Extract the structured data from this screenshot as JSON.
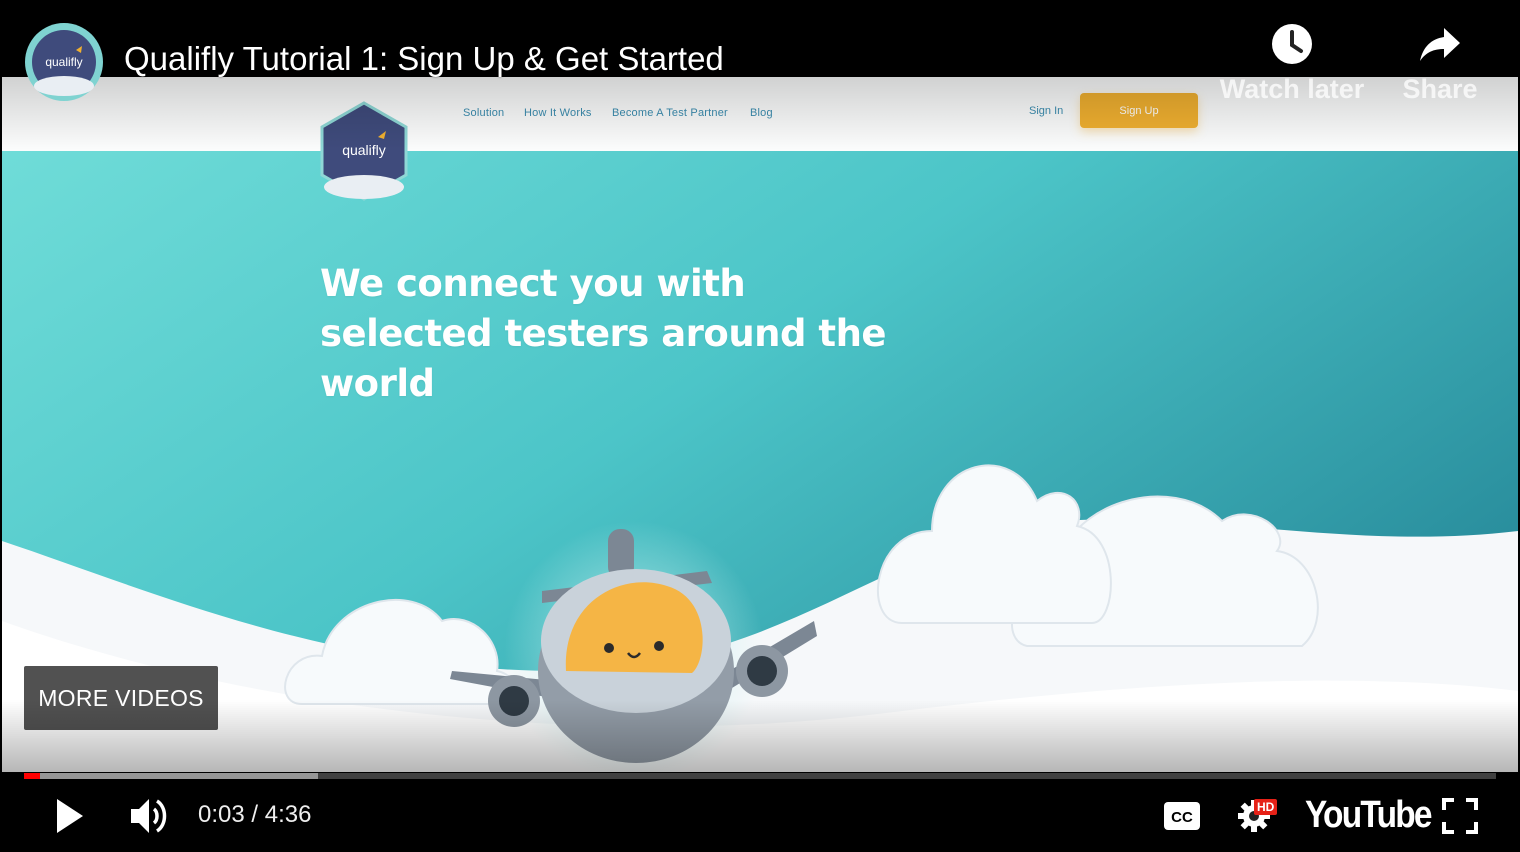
{
  "player": {
    "title": "Qualifly Tutorial 1: Sign Up & Get Started",
    "channel_logo_text": "qualifly",
    "watch_later_label": "Watch later",
    "share_label": "Share",
    "more_videos_label": "MORE VIDEOS",
    "current_time": "0:03",
    "time_separator": "/",
    "duration": "4:36",
    "time_display": "0:03 / 4:36",
    "progress_played": 0.011,
    "progress_buffered": 0.2,
    "brand_label": "YouTube",
    "hd_badge": "HD",
    "icons": {
      "play": "play-icon",
      "volume": "volume-icon",
      "captions": "cc-icon",
      "settings": "gear-icon",
      "fullscreen": "fullscreen-icon",
      "watch_later": "clock-icon",
      "share": "share-arrow-icon"
    },
    "colors": {
      "progress": "#ff0000",
      "hd": "#e62117"
    }
  },
  "site": {
    "logo_text": "qualifly",
    "nav": [
      "Solution",
      "How It Works",
      "Become A Test Partner",
      "Blog"
    ],
    "sign_in": "Sign In",
    "sign_up": "Sign Up",
    "headline": [
      "We connect you with",
      "selected testers around the",
      "world"
    ],
    "colors": {
      "teal": "#4ecfcf",
      "teal_dark": "#2a95a3",
      "cta": "#f0b030",
      "nav_text": "#3b8db0"
    }
  }
}
